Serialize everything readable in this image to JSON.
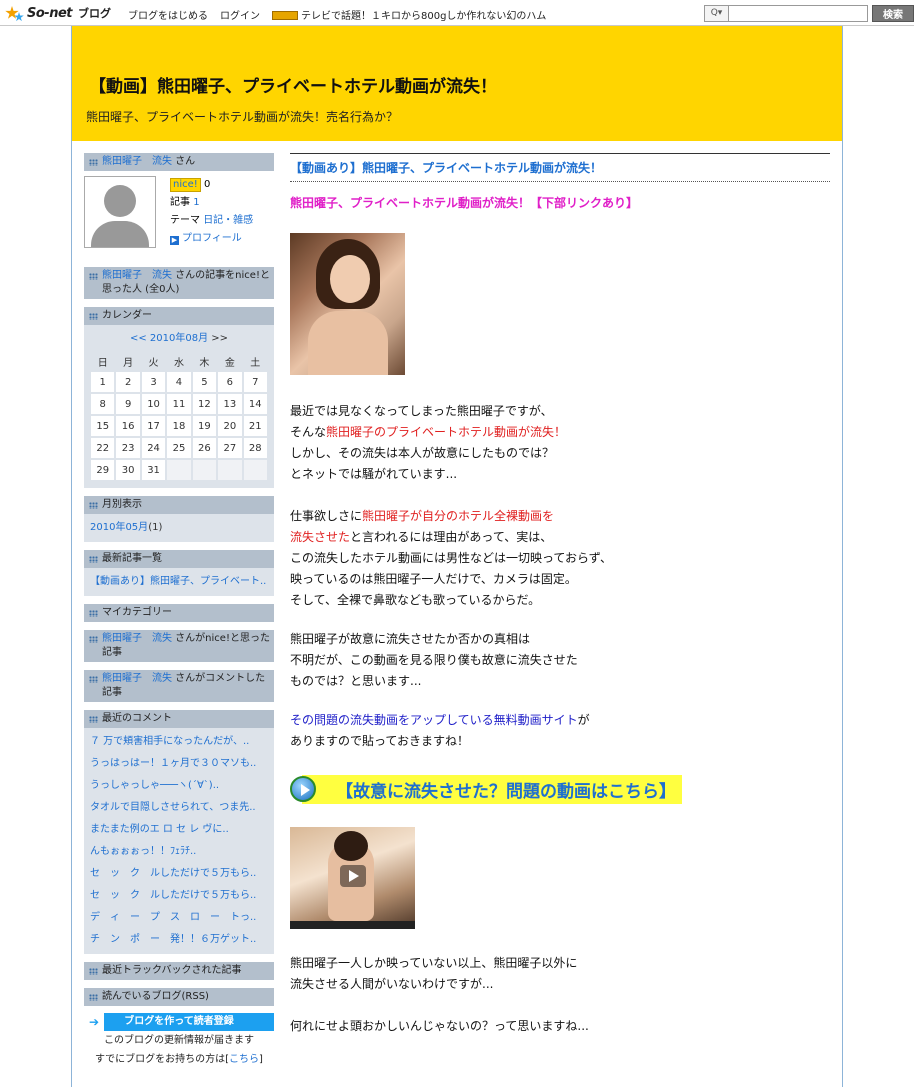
{
  "topbar": {
    "logo_brand": "So-net",
    "logo_suffix": "ブログ",
    "nav": [
      "ブログをはじめる",
      "ログイン"
    ],
    "ad_text": "テレビで話題！１キロから800gしか作れない幻のハム",
    "search_button": "検索",
    "search_icon_text": "Q▾"
  },
  "header": {
    "title": "【動画】熊田曜子、プライベートホテル動画が流失！",
    "description": "熊田曜子、プライベートホテル動画が流失！売名行為か？"
  },
  "sidebar": {
    "profile": {
      "user_link": "熊田曜子　流失",
      "san": " さん",
      "nice_label": "nice!",
      "nice_count": "0",
      "articles_label": "記事",
      "articles_count": "1",
      "theme_label": "テーマ",
      "theme_value": "日記・雑感",
      "profile_link": "プロフィール"
    },
    "nice_people": {
      "user_link": "熊田曜子　流失",
      "text": " さんの記事をnice!と思った人 (全0人)"
    },
    "calendar": {
      "heading": "カレンダー",
      "prev": "<<",
      "month": "2010年08月",
      "next": ">>",
      "weekdays": [
        "日",
        "月",
        "火",
        "水",
        "木",
        "金",
        "土"
      ],
      "weeks": [
        [
          "1",
          "2",
          "3",
          "4",
          "5",
          "6",
          "7"
        ],
        [
          "8",
          "9",
          "10",
          "11",
          "12",
          "13",
          "14"
        ],
        [
          "15",
          "16",
          "17",
          "18",
          "19",
          "20",
          "21"
        ],
        [
          "22",
          "23",
          "24",
          "25",
          "26",
          "27",
          "28"
        ],
        [
          "29",
          "30",
          "31",
          "",
          "",
          "",
          ""
        ]
      ]
    },
    "monthly": {
      "heading": "月別表示",
      "item": "2010年05月",
      "count": "(1)"
    },
    "recent_posts": {
      "heading": "最新記事一覧",
      "item": "【動画あり】熊田曜子、プライベート.."
    },
    "my_category": {
      "heading": "マイカテゴリー"
    },
    "nice_given": {
      "user_link": "熊田曜子　流失",
      "text": " さんがnice!と思った記事"
    },
    "commented": {
      "user_link": "熊田曜子　流失",
      "text": " さんがコメントした記事"
    },
    "recent_comments": {
      "heading": "最近のコメント",
      "items": [
        "７ 万で頬害相手になったんだが、..",
        "うっはっはー！１ヶ月で３０マソも..",
        "うっしゃっしゃ───ヽ(´∀`)..",
        "タオルで目隠しさせられて、つま先..",
        "またまた例のエ ロ セ レ ヴに..",
        "んもぉぉぉっ！！ﾌｪﾗﾁ..",
        "セ　ッ　ク　ルしただけで５万もら..",
        "セ　ッ　ク　ルしただけで５万もら..",
        "デ　ィ　ー　プ　ス　ロ　ー　トっ..",
        "チ　ン　ポ　ー　発！！６万ゲット.."
      ]
    },
    "trackbacks": {
      "heading": "最近トラックバックされた記事"
    },
    "reading": {
      "heading": "読んでいるブログ(RSS)"
    },
    "rss_button": "ブログを作って読者登録",
    "rss_line1": "このブログの更新情報が届きます",
    "rss_line2_pre": "すでにブログをお持ちの方は[",
    "rss_line2_link": "こちら",
    "rss_line2_post": "]"
  },
  "post": {
    "title": "【動画あり】熊田曜子、プライベートホテル動画が流失！",
    "lead": "熊田曜子、プライベートホテル動画が流失！【下部リンクあり】",
    "p1_l1": "最近では見なくなってしまった熊田曜子ですが、",
    "p1_l2_pre": "そんな",
    "p1_l2_red": "熊田曜子のプライベートホテル動画が流失！",
    "p1_l3": "しかし、その流失は本人が故意にしたものでは？",
    "p1_l4": "とネットでは騒がれています...",
    "p2_l1_pre": "仕事欲しさに",
    "p2_l1_red": "熊田曜子が自分のホテル全裸動画を",
    "p2_l2_red": "流失させた",
    "p2_l2_post": "と言われるには理由があって、実は、",
    "p2_l3": "この流失したホテル動画には男性などは一切映っておらず、",
    "p2_l4": "映っているのは熊田曜子一人だけで、カメラは固定。",
    "p2_l5": "そして、全裸で鼻歌なども歌っているからだ。",
    "p3_l1": "熊田曜子が故意に流失させたか否かの真相は",
    "p3_l2": "不明だが、この動画を見る限り僕も故意に流失させた",
    "p3_l3": "ものでは？と思います...",
    "p4_l1_link": "その問題の流失動画をアップしている無料動画サイト",
    "p4_l1_post": "が",
    "p4_l2": "ありますので貼っておきますね！",
    "banner": "【故意に流失させた？問題の動画はこちら】",
    "p5_l1": "熊田曜子一人しか映っていない以上、熊田曜子以外に",
    "p5_l2": "流失させる人間がいないわけですが...",
    "p6_l1": "何れにせよ頭おかしいんじゃないの？って思いますね..."
  },
  "colors": {
    "header_bg": "#ffd500",
    "link": "#1e6fd0",
    "accent_magenta": "#e020c8",
    "accent_red": "#e02020",
    "banner_bg": "#ffff40"
  }
}
